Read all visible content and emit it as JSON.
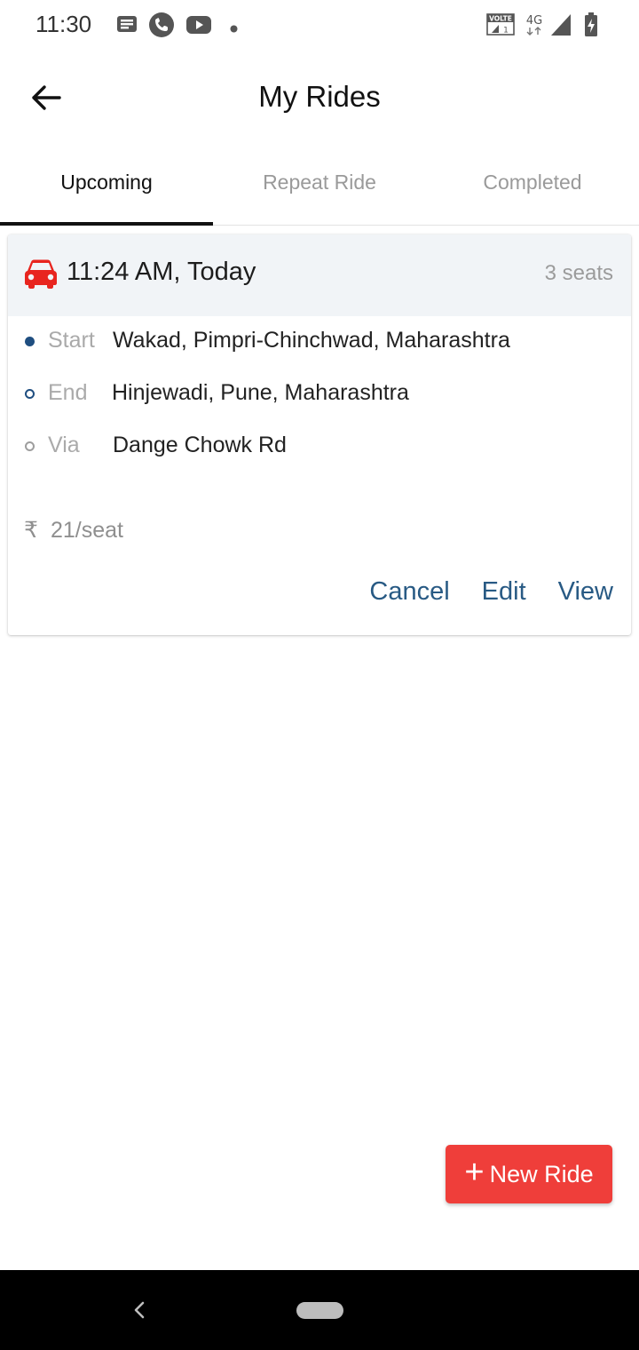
{
  "status_bar": {
    "time": "11:30",
    "left_icons": [
      "message-icon",
      "phone-icon",
      "youtube-icon",
      "dot-icon"
    ],
    "right_icons": [
      "volte-icon",
      "4g-icon",
      "signal-icon",
      "battery-charging-icon"
    ],
    "volte_text": "VOLTE",
    "network": "4G"
  },
  "app_bar": {
    "title": "My Rides",
    "back_icon": "arrow-back-icon"
  },
  "tabs": [
    {
      "label": "Upcoming",
      "active": true
    },
    {
      "label": "Repeat Ride",
      "active": false
    },
    {
      "label": "Completed",
      "active": false
    }
  ],
  "ride": {
    "time": "11:24 AM, Today",
    "seats": "3 seats",
    "start_label": "Start",
    "start_value": "Wakad, Pimpri-Chinchwad, Maharashtra",
    "end_label": "End",
    "end_value": "Hinjewadi, Pune, Maharashtra",
    "via_label": "Via",
    "via_value": "Dange Chowk Rd",
    "currency_symbol": "₹",
    "price": "21/seat",
    "actions": {
      "cancel": "Cancel",
      "edit": "Edit",
      "view": "View"
    }
  },
  "fab": {
    "plus": "+",
    "label": "New Ride"
  },
  "colors": {
    "accent_red": "#ef3e3a",
    "car_red": "#e8251f",
    "link_blue": "#285a84",
    "dot_blue": "#1f4e80",
    "header_bg": "#f1f4f7"
  }
}
